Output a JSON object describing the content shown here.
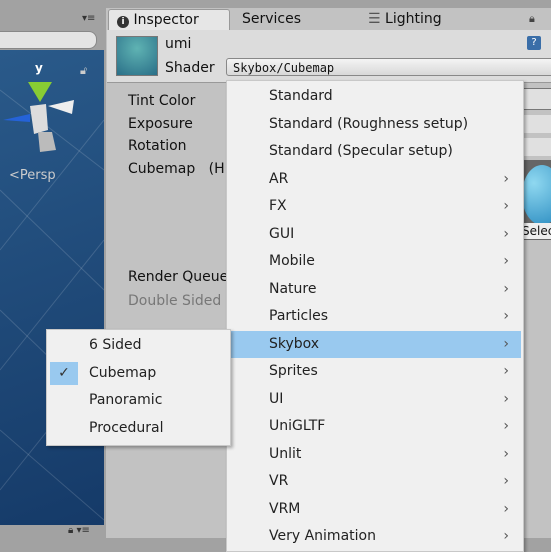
{
  "scene": {
    "persp_label": "Persp",
    "axis_y": "y"
  },
  "tabs": [
    {
      "label": "Inspector"
    },
    {
      "label": "Services"
    },
    {
      "label": "Lighting"
    }
  ],
  "material": {
    "name": "umi",
    "shader_label": "Shader",
    "shader_value": "Skybox/Cubemap"
  },
  "properties": {
    "tint": "Tint Color",
    "exposure": "Exposure",
    "rotation": "Rotation",
    "cubemap": "Cubemap",
    "cubemap_suffix": "(H",
    "render_queue": "Render Queue",
    "double_sided": "Double Sided"
  },
  "preview": {
    "select_label": "Selec"
  },
  "menu": {
    "items": [
      {
        "label": "Standard",
        "sub": false
      },
      {
        "label": "Standard (Roughness setup)",
        "sub": false
      },
      {
        "label": "Standard (Specular setup)",
        "sub": false
      },
      {
        "label": "AR",
        "sub": true
      },
      {
        "label": "FX",
        "sub": true
      },
      {
        "label": "GUI",
        "sub": true
      },
      {
        "label": "Mobile",
        "sub": true
      },
      {
        "label": "Nature",
        "sub": true
      },
      {
        "label": "Particles",
        "sub": true
      },
      {
        "label": "Skybox",
        "sub": true,
        "highlighted": true
      },
      {
        "label": "Sprites",
        "sub": true
      },
      {
        "label": "UI",
        "sub": true
      },
      {
        "label": "UniGLTF",
        "sub": true
      },
      {
        "label": "Unlit",
        "sub": true
      },
      {
        "label": "VR",
        "sub": true
      },
      {
        "label": "VRM",
        "sub": true
      },
      {
        "label": "Very Animation",
        "sub": true
      }
    ]
  },
  "submenu": {
    "items": [
      {
        "label": "6 Sided",
        "checked": false
      },
      {
        "label": "Cubemap",
        "checked": true
      },
      {
        "label": "Panoramic",
        "checked": false
      },
      {
        "label": "Procedural",
        "checked": false
      }
    ]
  },
  "colors": {
    "highlight": "#99c9ef",
    "scene_bg": "#1d4a7a"
  }
}
